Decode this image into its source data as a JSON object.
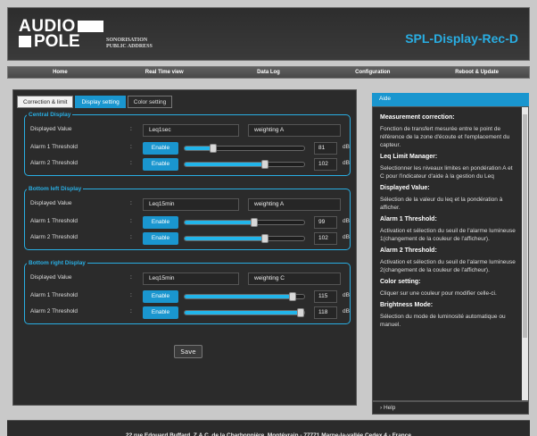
{
  "brand": {
    "line1": "AUDIO",
    "line2": "POLE",
    "sub1": "SONORISATION",
    "sub2": "PUBLIC ADDRESS"
  },
  "device_title": "SPL-Display-Rec-D",
  "nav": [
    "Home",
    "Real Time view",
    "Data Log",
    "Configuration",
    "Reboot & Update"
  ],
  "tabs": [
    "Correction & limit",
    "Display setting",
    "Color setting"
  ],
  "labels": {
    "displayed_value": "Displayed Value",
    "alarm1": "Alarm 1 Threshold",
    "alarm2": "Alarm 2 Threshold",
    "colon": ":",
    "enable": "Enable",
    "unit": "dB",
    "save": "Save"
  },
  "sections": [
    {
      "title": "Central Display",
      "value": "Leq1sec",
      "weighting": "weighting A",
      "alarm1": "81",
      "alarm1_level": 0.24,
      "alarm2": "102",
      "alarm2_level": 0.67
    },
    {
      "title": "Bottom left Display",
      "value": "Leq15min",
      "weighting": "weighting A",
      "alarm1": "99",
      "alarm1_level": 0.58,
      "alarm2": "102",
      "alarm2_level": 0.67
    },
    {
      "title": "Bottom right Display",
      "value": "Leq15min",
      "weighting": "weighting C",
      "alarm1": "115",
      "alarm1_level": 0.9,
      "alarm2": "118",
      "alarm2_level": 0.97
    }
  ],
  "aside": {
    "header": "Aide",
    "help_label": "Help",
    "blocks": [
      {
        "h": "Measurement correction:",
        "p": "Fonction de transfert mesurée entre le point de référence de la zone d'écoute et l'emplacement du capteur."
      },
      {
        "h": "Leq Limit Manager:",
        "p": "Selectionner les niveaux limites en pondération A et C pour l'indicateur d'aide à la gestion du Leq"
      },
      {
        "h": "Displayed Value:",
        "p": "Sélection de la valeur du leq et la pondération à afficher."
      },
      {
        "h": "Alarm 1 Threshold:",
        "p": "Activation et sélection du seuil de l'alarme lumineuse 1(changement de la couleur de l'afficheur)."
      },
      {
        "h": "Alarm 2 Threshold:",
        "p": "Activation et sélection du seuil de l'alarme lumineuse 2(changement de la couleur de l'afficheur)."
      },
      {
        "h": "Color setting:",
        "p": "Cliquer sur une couleur pour modifier celle-ci."
      },
      {
        "h": "Brightness Mode:",
        "p": "Sélection du mode de luminosité automatique ou manuel."
      }
    ]
  },
  "footer": "22 rue Edouard Buffard, Z.A.C. de la Charbonnière, Montévrain - 77771 Marne-la-vallée Cedex 4 - France"
}
